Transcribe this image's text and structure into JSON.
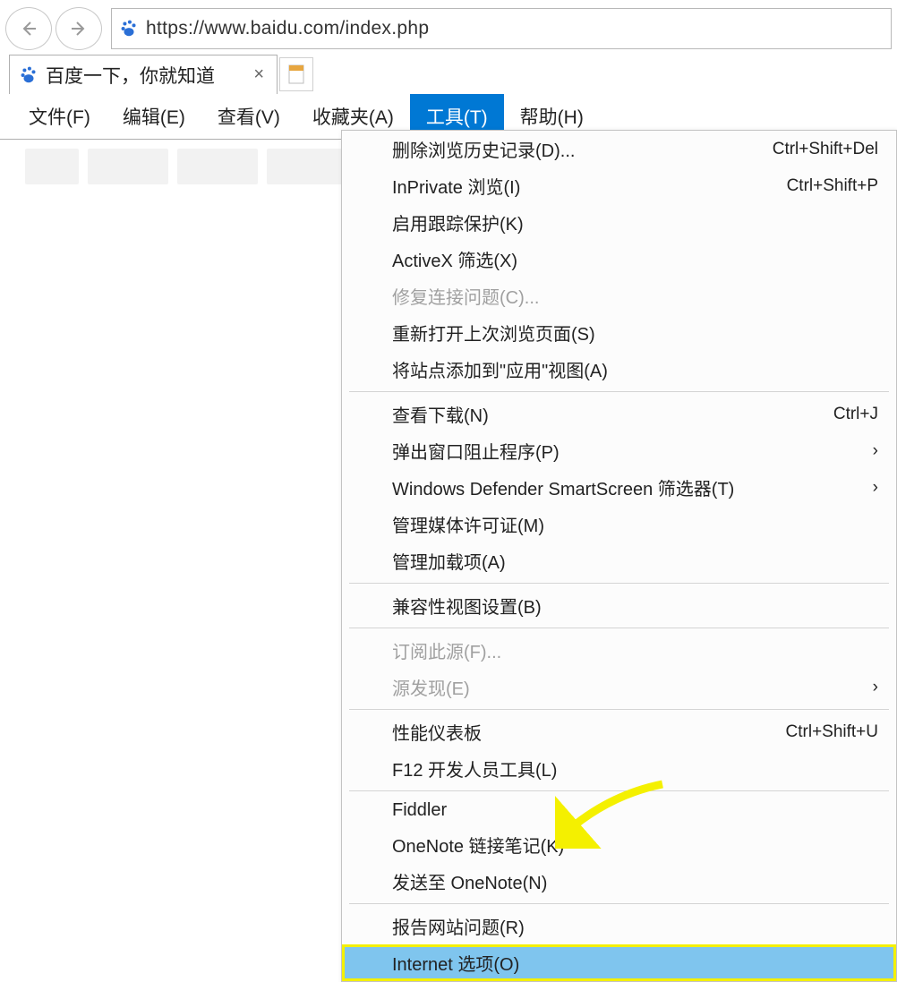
{
  "nav": {
    "url": "https://www.baidu.com/index.php"
  },
  "tab": {
    "title": "百度一下，你就知道",
    "close": "×"
  },
  "menubar": {
    "file": "文件(F)",
    "edit": "编辑(E)",
    "view": "查看(V)",
    "favorites": "收藏夹(A)",
    "tools": "工具(T)",
    "help": "帮助(H)"
  },
  "tools_menu": {
    "groups": [
      [
        {
          "label": "删除浏览历史记录(D)...",
          "shortcut": "Ctrl+Shift+Del",
          "disabled": false,
          "submenu": false
        },
        {
          "label": "InPrivate 浏览(I)",
          "shortcut": "Ctrl+Shift+P",
          "disabled": false,
          "submenu": false
        },
        {
          "label": "启用跟踪保护(K)",
          "shortcut": "",
          "disabled": false,
          "submenu": false
        },
        {
          "label": "ActiveX 筛选(X)",
          "shortcut": "",
          "disabled": false,
          "submenu": false
        },
        {
          "label": "修复连接问题(C)...",
          "shortcut": "",
          "disabled": true,
          "submenu": false
        },
        {
          "label": "重新打开上次浏览页面(S)",
          "shortcut": "",
          "disabled": false,
          "submenu": false
        },
        {
          "label": "将站点添加到\"应用\"视图(A)",
          "shortcut": "",
          "disabled": false,
          "submenu": false
        }
      ],
      [
        {
          "label": "查看下载(N)",
          "shortcut": "Ctrl+J",
          "disabled": false,
          "submenu": false
        },
        {
          "label": "弹出窗口阻止程序(P)",
          "shortcut": "",
          "disabled": false,
          "submenu": true
        },
        {
          "label": "Windows Defender SmartScreen 筛选器(T)",
          "shortcut": "",
          "disabled": false,
          "submenu": true
        },
        {
          "label": "管理媒体许可证(M)",
          "shortcut": "",
          "disabled": false,
          "submenu": false
        },
        {
          "label": "管理加载项(A)",
          "shortcut": "",
          "disabled": false,
          "submenu": false
        }
      ],
      [
        {
          "label": "兼容性视图设置(B)",
          "shortcut": "",
          "disabled": false,
          "submenu": false
        }
      ],
      [
        {
          "label": "订阅此源(F)...",
          "shortcut": "",
          "disabled": true,
          "submenu": false
        },
        {
          "label": "源发现(E)",
          "shortcut": "",
          "disabled": true,
          "submenu": true
        }
      ],
      [
        {
          "label": "性能仪表板",
          "shortcut": "Ctrl+Shift+U",
          "disabled": false,
          "submenu": false
        },
        {
          "label": "F12 开发人员工具(L)",
          "shortcut": "",
          "disabled": false,
          "submenu": false
        }
      ],
      [
        {
          "label": "Fiddler",
          "shortcut": "",
          "disabled": false,
          "submenu": false
        },
        {
          "label": "OneNote 链接笔记(K)",
          "shortcut": "",
          "disabled": false,
          "submenu": false
        },
        {
          "label": "发送至 OneNote(N)",
          "shortcut": "",
          "disabled": false,
          "submenu": false
        }
      ],
      [
        {
          "label": "报告网站问题(R)",
          "shortcut": "",
          "disabled": false,
          "submenu": false
        },
        {
          "label": "Internet 选项(O)",
          "shortcut": "",
          "disabled": false,
          "submenu": false,
          "highlight": true,
          "outlined": true
        }
      ]
    ]
  }
}
